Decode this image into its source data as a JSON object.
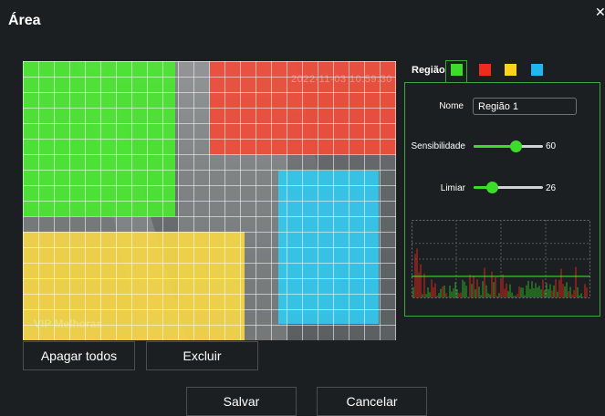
{
  "dialog": {
    "title": "Área",
    "close_icon": "close-icon"
  },
  "video": {
    "timestamp": "2022-11-03 10:59:30",
    "watermark": "VIP Melhoras"
  },
  "buttons": {
    "clear_all": "Apagar todos",
    "delete": "Excluir",
    "save": "Salvar",
    "cancel": "Cancelar"
  },
  "regions": {
    "label": "Região",
    "colors": [
      "#3ddc2a",
      "#ee2b1c",
      "#ffd21e",
      "#20b7ef"
    ],
    "selected": 0
  },
  "settings": {
    "name_label": "Nome",
    "name_value": "Região 1",
    "sensitivity_label": "Sensibilidade",
    "sensitivity_value": "60",
    "sensitivity_level": 60,
    "threshold_label": "Limiar",
    "threshold_value": "26",
    "threshold_level": 26
  },
  "colors": {
    "accent_green": "#3ddc2a",
    "panel_border": "#3ea63a",
    "background": "#1c1f21"
  }
}
